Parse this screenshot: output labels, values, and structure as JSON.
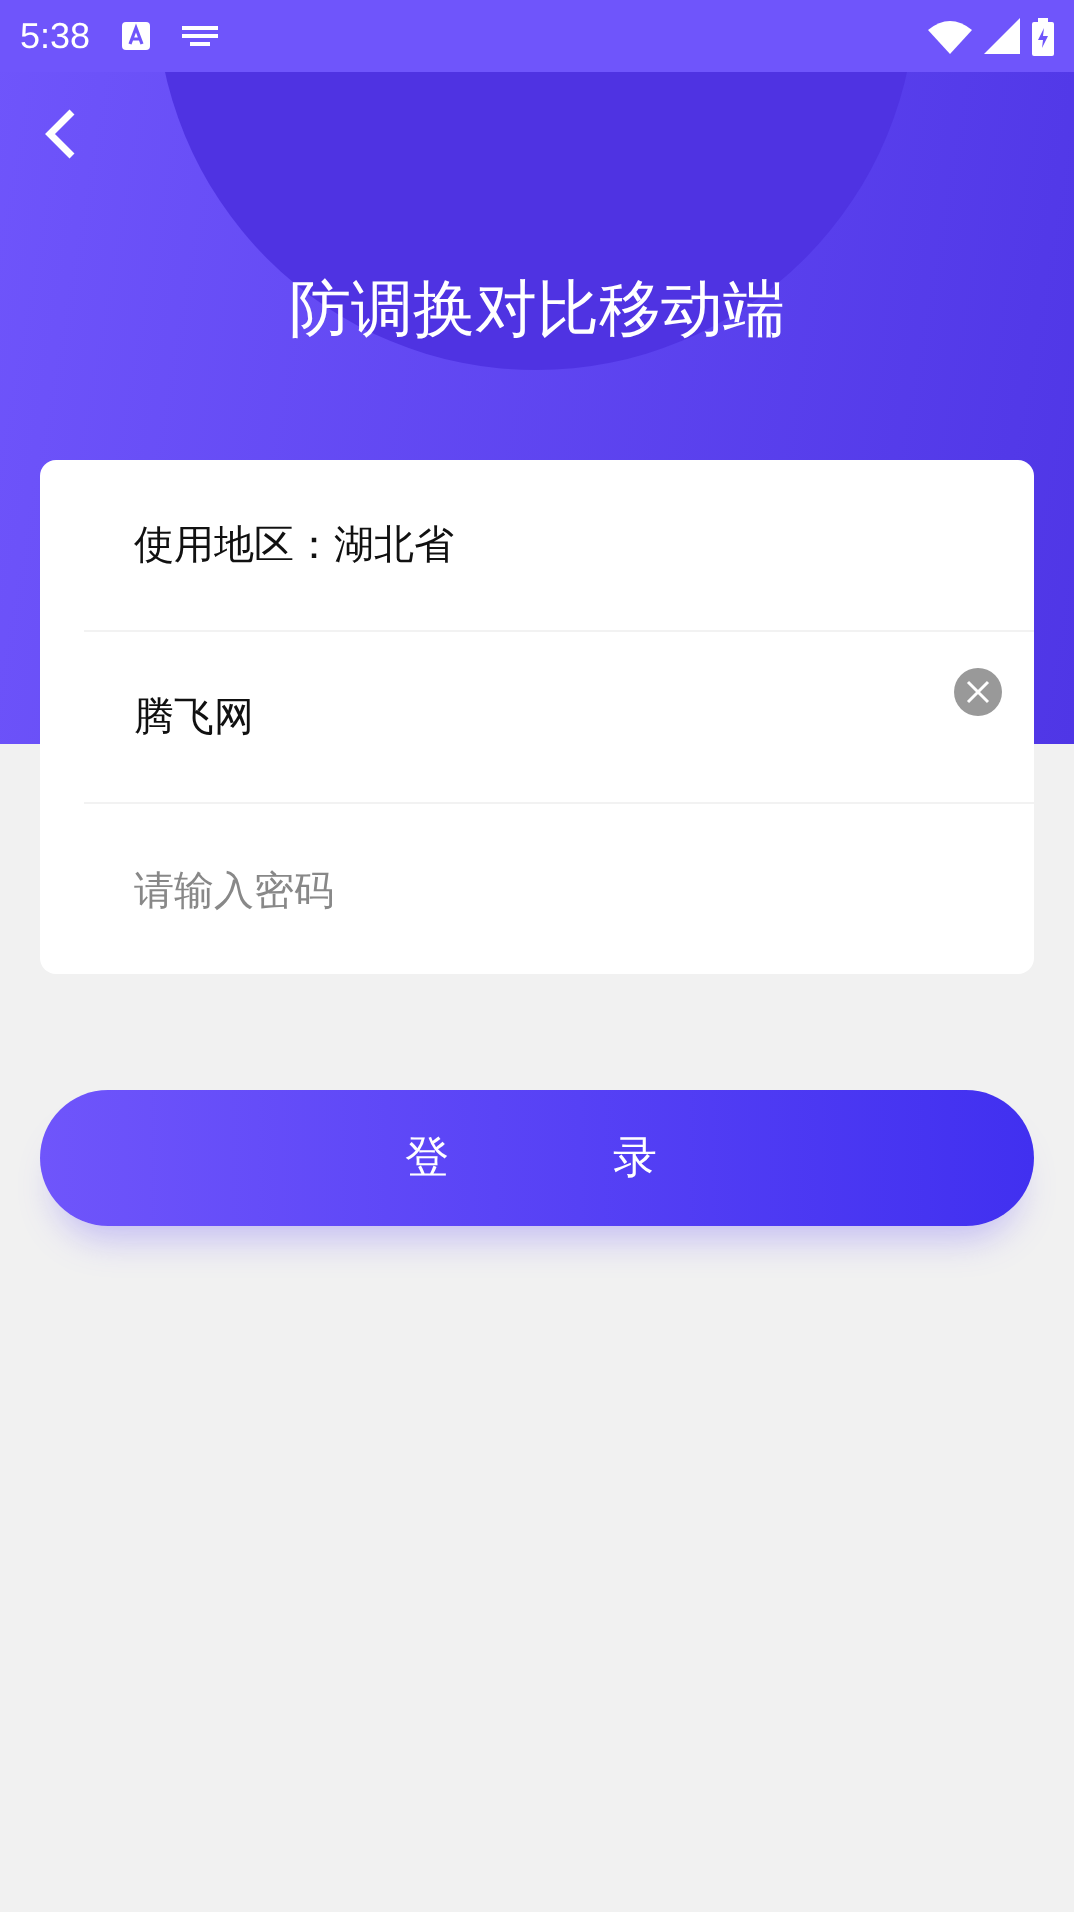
{
  "status_bar": {
    "time": "5:38"
  },
  "header": {
    "title": "防调换对比移动端"
  },
  "form": {
    "region": "使用地区：湖北省",
    "username": {
      "value": "腾飞网"
    },
    "password": {
      "placeholder": "请输入密码"
    }
  },
  "login_button": {
    "label": "登录"
  }
}
